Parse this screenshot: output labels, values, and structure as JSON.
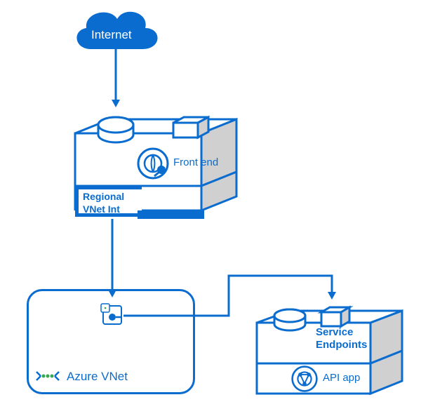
{
  "diagram": {
    "nodes": {
      "internet": {
        "label": "Internet"
      },
      "frontend": {
        "label": "Front end"
      },
      "regional_vnet_int": {
        "label_line1": "Regional",
        "label_line2": "VNet Int"
      },
      "azure_vnet": {
        "label": "Azure VNet"
      },
      "service_endpoints": {
        "label_line1": "Service",
        "label_line2": "Endpoints"
      },
      "api_app": {
        "label": "API app"
      }
    },
    "icons": {
      "cloud": "cloud-icon",
      "web_globe": "web-globe-icon",
      "vnet": "vnet-icon",
      "api_globe": "api-globe-icon"
    },
    "colors": {
      "azure_blue": "#0a6cce",
      "light_fill": "#ffffff",
      "shade": "#d0d0d0"
    }
  }
}
